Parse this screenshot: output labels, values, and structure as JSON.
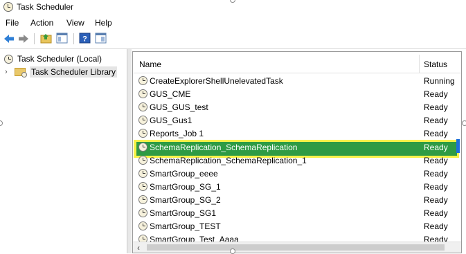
{
  "window": {
    "title": "Task Scheduler",
    "icon": "clock-icon"
  },
  "menu": {
    "items": [
      "File",
      "Action",
      "View",
      "Help"
    ]
  },
  "toolbar": {
    "back_icon": "arrow-left-icon",
    "forward_icon": "arrow-right-icon",
    "buttons": [
      "up-folder-icon",
      "show-hide-tree-icon",
      "help-icon",
      "console-tree-icon"
    ]
  },
  "tree": {
    "root": "Task Scheduler (Local)",
    "library": "Task Scheduler Library"
  },
  "list": {
    "columns": {
      "name": "Name",
      "status": "Status"
    },
    "rows": [
      {
        "name": "CreateExplorerShellUnelevatedTask",
        "status": "Running"
      },
      {
        "name": "GUS_CME",
        "status": "Ready"
      },
      {
        "name": "GUS_GUS_test",
        "status": "Ready"
      },
      {
        "name": "GUS_Gus1",
        "status": "Ready"
      },
      {
        "name": "Reports_Job 1",
        "status": "Ready"
      },
      {
        "name": "SchemaReplication_SchemaReplication",
        "status": "Ready"
      },
      {
        "name": "SchemaReplication_SchemaReplication_1",
        "status": "Ready"
      },
      {
        "name": "SmartGroup_eeee",
        "status": "Ready"
      },
      {
        "name": "SmartGroup_SG_1",
        "status": "Ready"
      },
      {
        "name": "SmartGroup_SG_2",
        "status": "Ready"
      },
      {
        "name": "SmartGroup_SG1",
        "status": "Ready"
      },
      {
        "name": "SmartGroup_TEST",
        "status": "Ready"
      },
      {
        "name": "SmartGroup_Test_Aaaa",
        "status": "Ready"
      }
    ],
    "selected_index": 5
  },
  "colors": {
    "highlight_outline": "#f7f24a",
    "selection": "#2e9b44",
    "accent": "#1e6fd9"
  }
}
